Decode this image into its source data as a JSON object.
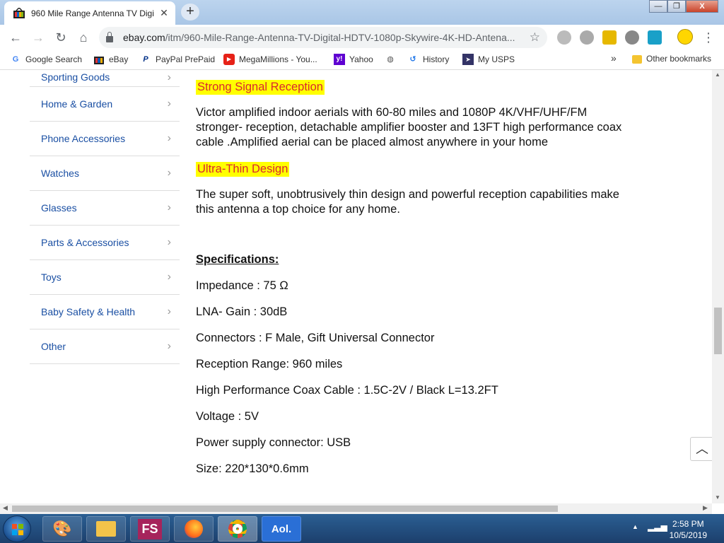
{
  "browser": {
    "tab_title": "960 Mile Range Antenna TV Digi",
    "tab_close": "✕",
    "new_tab": "+",
    "url_host": "ebay.com",
    "url_path": "/itm/960-Mile-Range-Antenna-TV-Digital-HDTV-1080p-Skywire-4K-HD-Antena...",
    "window_controls": {
      "minimize": "—",
      "maximize": "❐",
      "close": "X"
    }
  },
  "bookmarks": [
    {
      "label": "Google Search",
      "icon": "google-icon"
    },
    {
      "label": "eBay",
      "icon": "ebay-icon"
    },
    {
      "label": "PayPal PrePaid",
      "icon": "paypal-icon"
    },
    {
      "label": "MegaMillions - You...",
      "icon": "youtube-icon"
    },
    {
      "label": "Yahoo",
      "icon": "yahoo-icon"
    },
    {
      "label": "",
      "icon": "globe-icon"
    },
    {
      "label": "History",
      "icon": "history-icon"
    },
    {
      "label": "My USPS",
      "icon": "usps-icon"
    }
  ],
  "bookmarks_overflow": "»",
  "other_bookmarks": "Other bookmarks",
  "sidebar": {
    "items": [
      {
        "label": "Sporting Goods"
      },
      {
        "label": "Home & Garden"
      },
      {
        "label": "Phone Accessories"
      },
      {
        "label": "Watches"
      },
      {
        "label": "Glasses"
      },
      {
        "label": "Parts & Accessories"
      },
      {
        "label": "Toys"
      },
      {
        "label": "Baby Safety & Health"
      },
      {
        "label": "Other"
      }
    ]
  },
  "content": {
    "heading1": "Strong Signal Reception",
    "para1_line1": "Victor amplified indoor aerials with 60-80 miles and 1080P 4K/VHF/UHF/FM",
    "para1_line2": "stronger- reception, detachable amplifier booster and 13FT high performance coax",
    "para1_line3": "cable .Amplified aerial can be placed almost anywhere in your home",
    "heading2": "Ultra-Thin Design",
    "para2_line1": "The super soft, unobtrusively thin design and powerful reception capabilities make",
    "para2_line2": "this antenna a top choice for any home.",
    "spec_title": "Specifications:",
    "specs": [
      "Impedance : 75 Ω",
      "LNA- Gain : 30dB",
      "Connectors : F Male, Gift Universal Connector",
      "Reception Range: 960 miles",
      "High Performance Coax Cable : 1.5C-2V / Black L=13.2FT",
      "Voltage : 5V",
      "Power supply connector: USB",
      "Size: 220*130*0.6mm"
    ]
  },
  "taskbar": {
    "apps": [
      {
        "label": "",
        "icon": "paint-icon"
      },
      {
        "label": "",
        "icon": "explorer-icon"
      },
      {
        "label": "FS",
        "icon": "fs-app-icon"
      },
      {
        "label": "",
        "icon": "firefox-icon"
      },
      {
        "label": "",
        "icon": "chrome-icon"
      },
      {
        "label": "Aol.",
        "icon": "aol-icon"
      }
    ],
    "time": "2:58 PM",
    "date": "10/5/2019"
  },
  "colors": {
    "link": "#1a4fa3",
    "highlight_bg": "#ffff00",
    "highlight_text": "#d9272e"
  }
}
